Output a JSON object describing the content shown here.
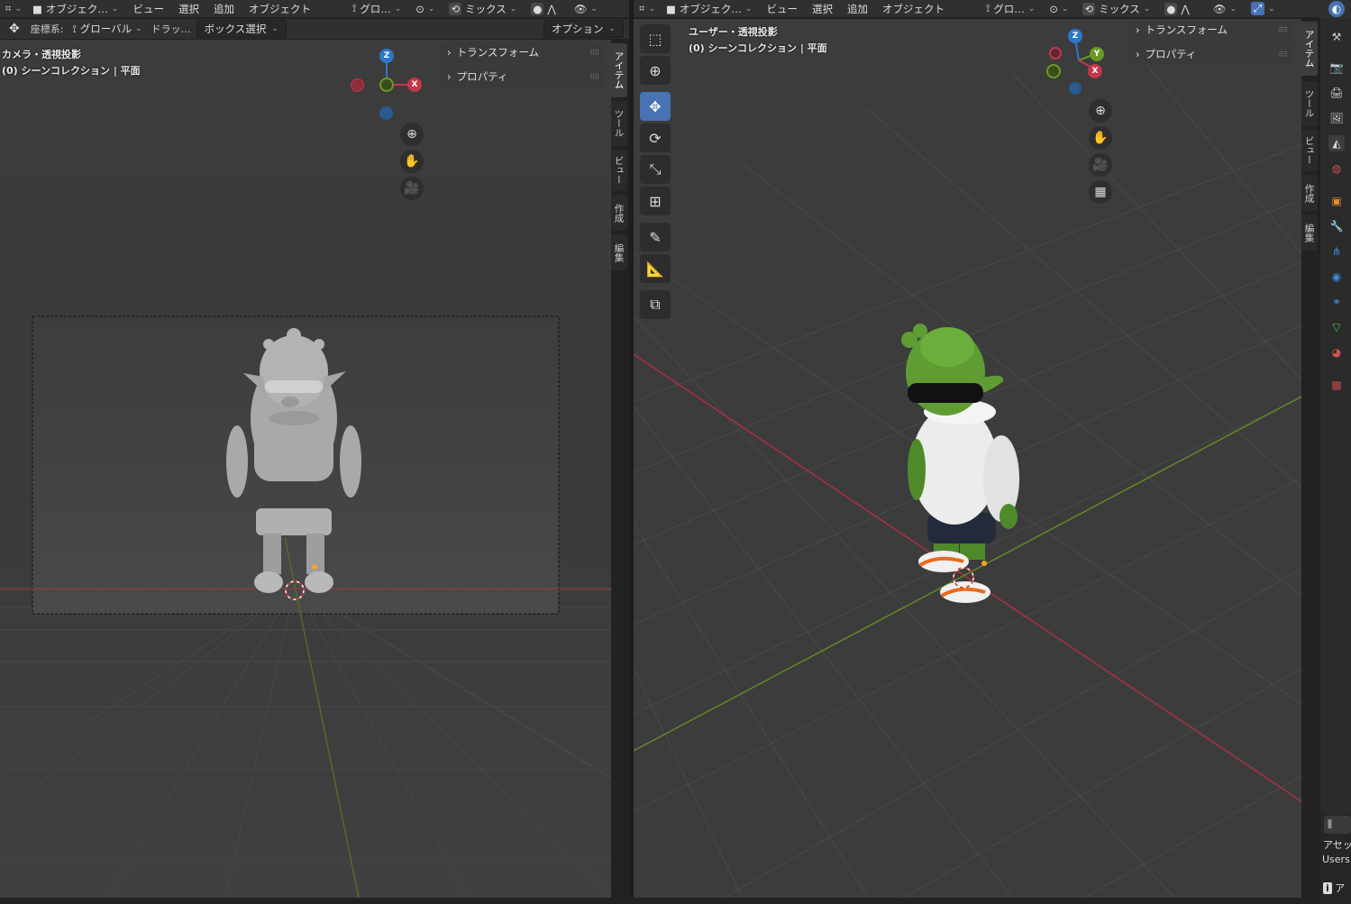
{
  "left": {
    "header": {
      "mode": "オブジェク…",
      "menus": [
        "ビュー",
        "選択",
        "追加",
        "オブジェクト"
      ],
      "transform_orient": "グロ…",
      "shading": "ミックス"
    },
    "toolbar": {
      "coord_label": "座標系:",
      "coord_value": "グローバル",
      "drag_label": "ドラッ…",
      "drag_value": "ボックス選択",
      "options": "オプション"
    },
    "overlay": {
      "view_name": "カメラ・透視投影",
      "collection": "(0) シーンコレクション | 平面"
    },
    "npanel": [
      "トランスフォーム",
      "プロパティ"
    ],
    "tabs": [
      "アイテム",
      "ツール",
      "ビュー",
      "作成",
      "編集"
    ],
    "gizmo": {
      "z": "Z",
      "x": "X"
    }
  },
  "right": {
    "header": {
      "mode": "オブジェク…",
      "menus": [
        "ビュー",
        "選択",
        "追加",
        "オブジェクト"
      ],
      "transform_orient": "グロ…",
      "shading": "ミックス"
    },
    "overlay": {
      "view_name": "ユーザー・透視投影",
      "collection": "(0) シーンコレクション | 平面"
    },
    "npanel": [
      "トランスフォーム",
      "プロパティ"
    ],
    "tabs": [
      "アイテム",
      "ツール",
      "ビュー",
      "作成",
      "編集"
    ],
    "gizmo": {
      "z": "Z",
      "y": "Y",
      "x": "X"
    }
  },
  "asset": {
    "label": "アセッ",
    "path": "Users",
    "info": "ア"
  },
  "icons": {
    "tools": [
      "select-box-icon",
      "cursor-icon",
      "move-icon",
      "rotate-icon",
      "scale-icon",
      "transform-icon",
      "annotate-icon",
      "measure-icon",
      "add-cube-icon"
    ],
    "properties": [
      "tool-icon",
      "render-icon",
      "output-icon",
      "view-layer-icon",
      "scene-icon",
      "world-icon",
      "object-icon",
      "modifier-icon",
      "particles-icon",
      "physics-icon",
      "constraints-icon",
      "data-icon",
      "material-icon",
      "texture-icon"
    ]
  },
  "colors": {
    "x_axis": "#c5364a",
    "y_axis": "#6a9a24",
    "z_axis": "#2f78c8",
    "active_tool": "#4772b3",
    "character_skin": "#5f9d34",
    "hoodie": "#e8e8e8"
  }
}
